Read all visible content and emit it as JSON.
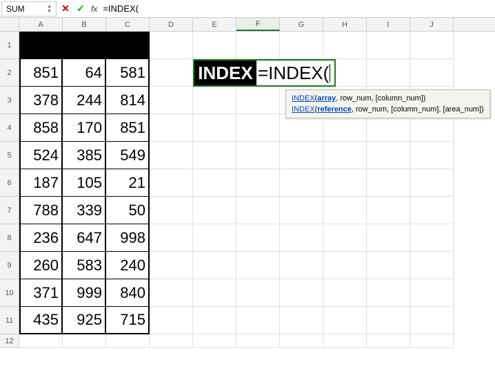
{
  "formula_bar": {
    "name_box": "SUM",
    "fx": "fx",
    "input": "=INDEX("
  },
  "columns": [
    "A",
    "B",
    "C",
    "D",
    "E",
    "F",
    "G",
    "H",
    "I",
    "J"
  ],
  "row_numbers": [
    "1",
    "2",
    "3",
    "4",
    "5",
    "6",
    "7",
    "8",
    "9",
    "10",
    "11",
    "12"
  ],
  "table": [
    [
      "851",
      "64",
      "581"
    ],
    [
      "378",
      "244",
      "814"
    ],
    [
      "858",
      "170",
      "851"
    ],
    [
      "524",
      "385",
      "549"
    ],
    [
      "187",
      "105",
      "21"
    ],
    [
      "788",
      "339",
      "50"
    ],
    [
      "236",
      "647",
      "998"
    ],
    [
      "260",
      "583",
      "240"
    ],
    [
      "371",
      "999",
      "840"
    ],
    [
      "435",
      "925",
      "715"
    ]
  ],
  "overlay": {
    "label": "INDEX",
    "formula": "=INDEX("
  },
  "tooltip": {
    "fn": "INDEX",
    "line1_arg1": "array",
    "line1_rest": ", row_num, [column_num])",
    "line2_arg1": "reference",
    "line2_rest": ", row_num, [column_num], [area_num])"
  },
  "chart_data": {
    "type": "table",
    "columns": [
      "A",
      "B",
      "C"
    ],
    "rows": [
      [
        851,
        64,
        581
      ],
      [
        378,
        244,
        814
      ],
      [
        858,
        170,
        851
      ],
      [
        524,
        385,
        549
      ],
      [
        187,
        105,
        21
      ],
      [
        788,
        339,
        50
      ],
      [
        236,
        647,
        998
      ],
      [
        260,
        583,
        240
      ],
      [
        371,
        999,
        840
      ],
      [
        435,
        925,
        715
      ]
    ]
  }
}
